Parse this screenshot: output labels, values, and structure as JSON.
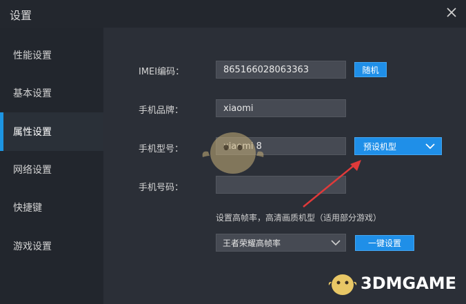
{
  "window": {
    "title": "设置",
    "close_icon": "close-icon"
  },
  "sidebar": {
    "active_color": "#1d95e2",
    "items": [
      {
        "label": "性能设置"
      },
      {
        "label": "基本设置"
      },
      {
        "label": "属性设置",
        "active": true
      },
      {
        "label": "网络设置"
      },
      {
        "label": "快捷键"
      },
      {
        "label": "游戏设置"
      }
    ]
  },
  "form": {
    "imei_label": "IMEI编码：",
    "imei_value": "865166028063363",
    "random_button": "随机",
    "brand_label": "手机品牌：",
    "brand_value": "xiaomi",
    "model_label": "手机型号：",
    "model_value": "xiaomi 8",
    "preset_model_button": "预设机型",
    "phone_label": "手机号码：",
    "phone_value": "",
    "high_fps_hint": "设置高帧率，高清画质机型（适用部分游戏）",
    "fps_select_value": "王者荣耀高帧率",
    "one_click_button": "一键设置"
  },
  "watermark": {
    "text": "3DMGAME"
  }
}
